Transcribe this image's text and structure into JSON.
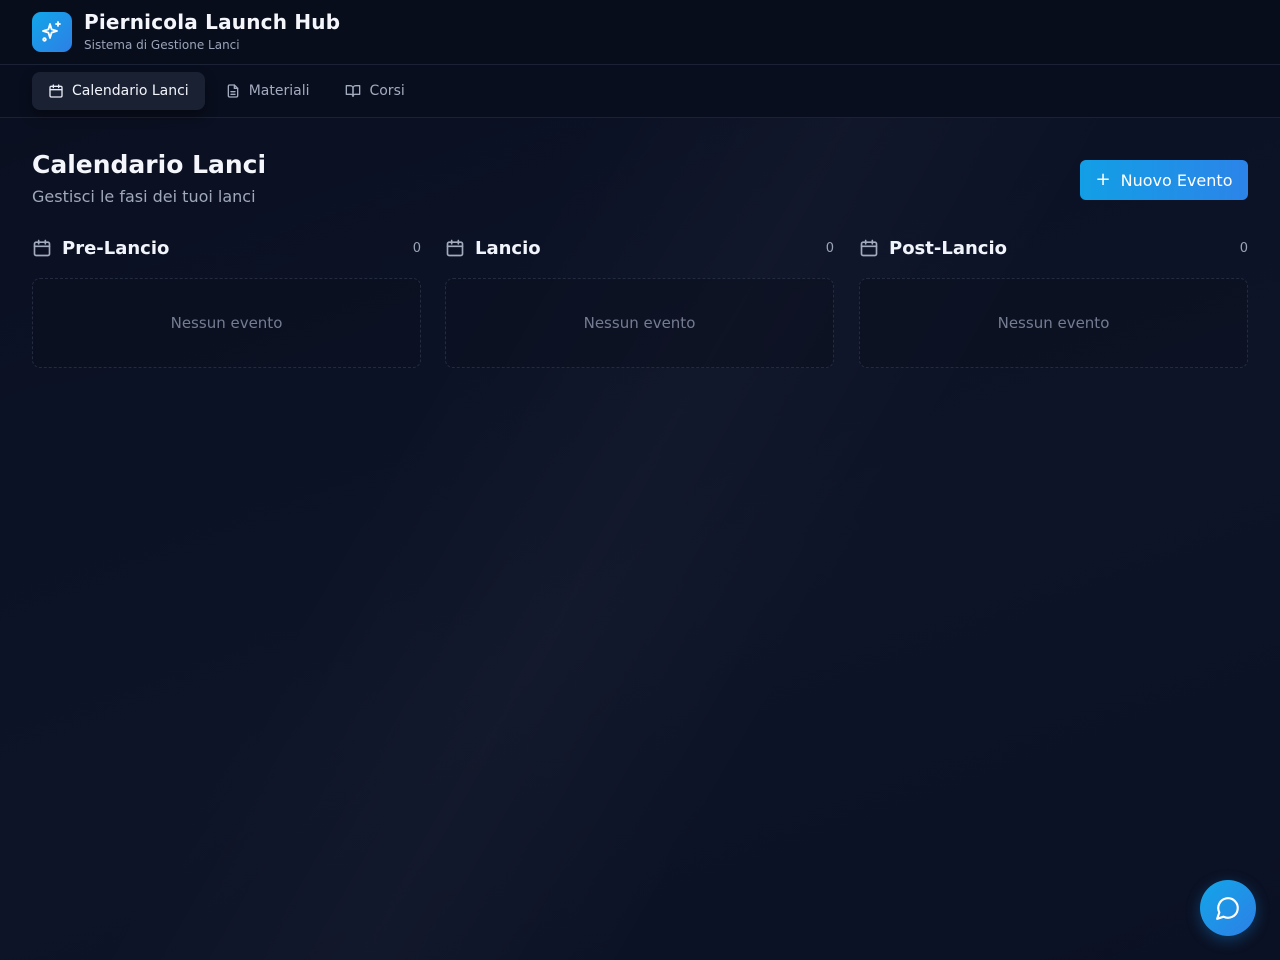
{
  "header": {
    "title": "Piernicola Launch Hub",
    "subtitle": "Sistema di Gestione Lanci",
    "logo_icon": "sparkles-icon"
  },
  "nav": {
    "tabs": [
      {
        "label": "Calendario Lanci",
        "icon": "calendar-icon",
        "active": true
      },
      {
        "label": "Materiali",
        "icon": "document-icon",
        "active": false
      },
      {
        "label": "Corsi",
        "icon": "book-open-icon",
        "active": false
      }
    ]
  },
  "main": {
    "title": "Calendario Lanci",
    "subtitle": "Gestisci le fasi dei tuoi lanci",
    "new_event_label": "Nuovo Evento",
    "columns": [
      {
        "title": "Pre-Lancio",
        "count": "0",
        "empty_text": "Nessun evento"
      },
      {
        "title": "Lancio",
        "count": "0",
        "empty_text": "Nessun evento"
      },
      {
        "title": "Post-Lancio",
        "count": "0",
        "empty_text": "Nessun evento"
      }
    ]
  },
  "chat": {
    "icon": "chat-bubble-icon"
  },
  "colors": {
    "accent": "#1a9be6",
    "background": "#0c1226",
    "surface": "#080d1c"
  }
}
